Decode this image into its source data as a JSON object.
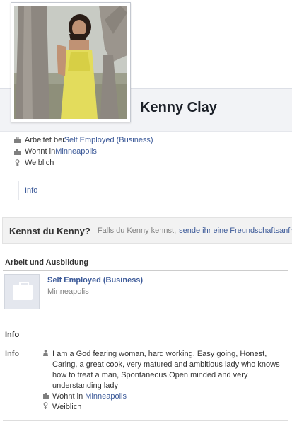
{
  "profile": {
    "name": "Kenny Clay"
  },
  "facts": [
    {
      "icon": "briefcase-icon",
      "prefix": "Arbeitet bei ",
      "link": "Self Employed (Business)"
    },
    {
      "icon": "home-icon",
      "prefix": "Wohnt in ",
      "link": "Minneapolis"
    },
    {
      "icon": "female-icon",
      "prefix": "Weiblich",
      "link": ""
    }
  ],
  "tabs": {
    "info_label": "Info"
  },
  "banner": {
    "question": "Kennst du Kenny?",
    "text": "Falls du Kenny kennst,",
    "link": "sende ihr eine Freundschaftsanfra"
  },
  "work": {
    "section_title": "Arbeit und Ausbildung",
    "employer": "Self Employed (Business)",
    "location": "Minneapolis"
  },
  "info": {
    "section_title": "Info",
    "label": "Info",
    "about": "I am a God fearing woman, hard working, Easy going, Honest, Caring, a great cook, very matured and ambitious lady who knows how to treat a man, Spontaneous,Open minded and very understanding lady",
    "lives_prefix": "Wohnt in ",
    "lives_link": "Minneapolis",
    "gender": "Weiblich"
  },
  "colors": {
    "link": "#3b5998",
    "header_band": "#f2f3f6",
    "banner_bg": "#f2f2f2"
  }
}
